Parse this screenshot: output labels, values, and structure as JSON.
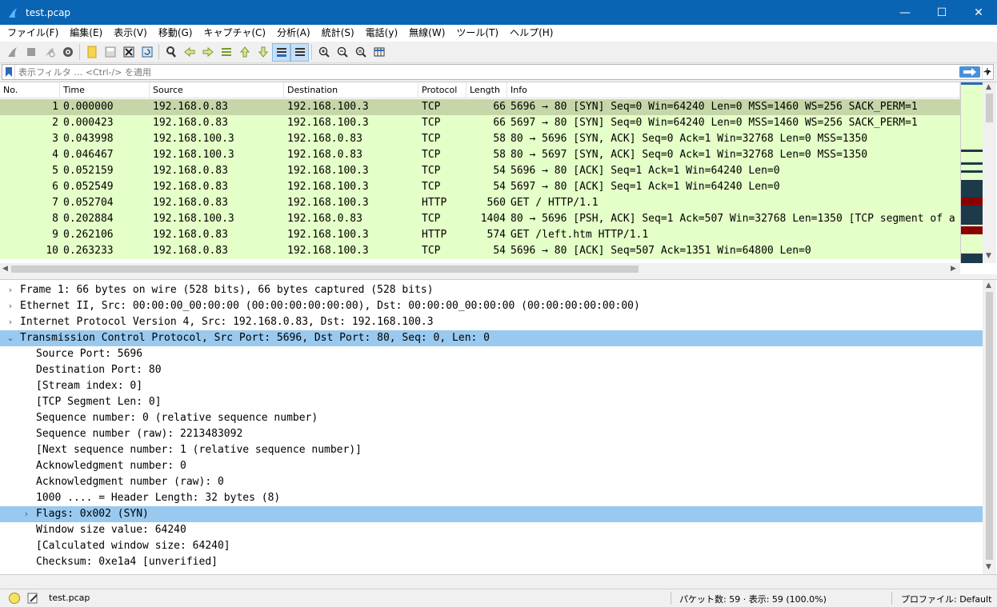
{
  "window": {
    "title": "test.pcap",
    "minimize": "—",
    "maximize": "☐",
    "close": "✕"
  },
  "menu": [
    "ファイル(F)",
    "編集(E)",
    "表示(V)",
    "移動(G)",
    "キャプチャ(C)",
    "分析(A)",
    "統計(S)",
    "電話(y)",
    "無線(W)",
    "ツール(T)",
    "ヘルプ(H)"
  ],
  "filter": {
    "placeholder": "表示フィルタ … <Ctrl-/> を適用",
    "value": ""
  },
  "packet_list": {
    "columns": [
      "No.",
      "Time",
      "Source",
      "Destination",
      "Protocol",
      "Length",
      "Info"
    ],
    "rows": [
      {
        "no": "1",
        "time": "0.000000",
        "src": "192.168.0.83",
        "dst": "192.168.100.3",
        "proto": "TCP",
        "len": "66",
        "info": "5696 → 80 [SYN] Seq=0 Win=64240 Len=0 MSS=1460 WS=256 SACK_PERM=1"
      },
      {
        "no": "2",
        "time": "0.000423",
        "src": "192.168.0.83",
        "dst": "192.168.100.3",
        "proto": "TCP",
        "len": "66",
        "info": "5697 → 80 [SYN] Seq=0 Win=64240 Len=0 MSS=1460 WS=256 SACK_PERM=1"
      },
      {
        "no": "3",
        "time": "0.043998",
        "src": "192.168.100.3",
        "dst": "192.168.0.83",
        "proto": "TCP",
        "len": "58",
        "info": "80 → 5696 [SYN, ACK] Seq=0 Ack=1 Win=32768 Len=0 MSS=1350"
      },
      {
        "no": "4",
        "time": "0.046467",
        "src": "192.168.100.3",
        "dst": "192.168.0.83",
        "proto": "TCP",
        "len": "58",
        "info": "80 → 5697 [SYN, ACK] Seq=0 Ack=1 Win=32768 Len=0 MSS=1350"
      },
      {
        "no": "5",
        "time": "0.052159",
        "src": "192.168.0.83",
        "dst": "192.168.100.3",
        "proto": "TCP",
        "len": "54",
        "info": "5696 → 80 [ACK] Seq=1 Ack=1 Win=64240 Len=0"
      },
      {
        "no": "6",
        "time": "0.052549",
        "src": "192.168.0.83",
        "dst": "192.168.100.3",
        "proto": "TCP",
        "len": "54",
        "info": "5697 → 80 [ACK] Seq=1 Ack=1 Win=64240 Len=0"
      },
      {
        "no": "7",
        "time": "0.052704",
        "src": "192.168.0.83",
        "dst": "192.168.100.3",
        "proto": "HTTP",
        "len": "560",
        "info": "GET / HTTP/1.1"
      },
      {
        "no": "8",
        "time": "0.202884",
        "src": "192.168.100.3",
        "dst": "192.168.0.83",
        "proto": "TCP",
        "len": "1404",
        "info": "80 → 5696 [PSH, ACK] Seq=1 Ack=507 Win=32768 Len=1350 [TCP segment of a"
      },
      {
        "no": "9",
        "time": "0.262106",
        "src": "192.168.0.83",
        "dst": "192.168.100.3",
        "proto": "HTTP",
        "len": "574",
        "info": "GET /left.htm HTTP/1.1"
      },
      {
        "no": "10",
        "time": "0.263233",
        "src": "192.168.0.83",
        "dst": "192.168.100.3",
        "proto": "TCP",
        "len": "54",
        "info": "5696 → 80 [ACK] Seq=507 Ack=1351 Win=64800 Len=0"
      }
    ]
  },
  "details": [
    {
      "text": "Frame 1: 66 bytes on wire (528 bits), 66 bytes captured (528 bits)",
      "indent": 0,
      "expander": "›",
      "hl": false
    },
    {
      "text": "Ethernet II, Src: 00:00:00_00:00:00 (00:00:00:00:00:00), Dst: 00:00:00_00:00:00 (00:00:00:00:00:00)",
      "indent": 0,
      "expander": "›",
      "hl": false
    },
    {
      "text": "Internet Protocol Version 4, Src: 192.168.0.83, Dst: 192.168.100.3",
      "indent": 0,
      "expander": "›",
      "hl": false
    },
    {
      "text": "Transmission Control Protocol, Src Port: 5696, Dst Port: 80, Seq: 0, Len: 0",
      "indent": 0,
      "expander": "⌄",
      "hl": true
    },
    {
      "text": "Source Port: 5696",
      "indent": 1,
      "expander": "",
      "hl": false
    },
    {
      "text": "Destination Port: 80",
      "indent": 1,
      "expander": "",
      "hl": false
    },
    {
      "text": "[Stream index: 0]",
      "indent": 1,
      "expander": "",
      "hl": false
    },
    {
      "text": "[TCP Segment Len: 0]",
      "indent": 1,
      "expander": "",
      "hl": false
    },
    {
      "text": "Sequence number: 0    (relative sequence number)",
      "indent": 1,
      "expander": "",
      "hl": false
    },
    {
      "text": "Sequence number (raw): 2213483092",
      "indent": 1,
      "expander": "",
      "hl": false
    },
    {
      "text": "[Next sequence number: 1    (relative sequence number)]",
      "indent": 1,
      "expander": "",
      "hl": false
    },
    {
      "text": "Acknowledgment number: 0",
      "indent": 1,
      "expander": "",
      "hl": false
    },
    {
      "text": "Acknowledgment number (raw): 0",
      "indent": 1,
      "expander": "",
      "hl": false
    },
    {
      "text": "1000 .... = Header Length: 32 bytes (8)",
      "indent": 1,
      "expander": "",
      "hl": false
    },
    {
      "text": "Flags: 0x002 (SYN)",
      "indent": 1,
      "expander": "›",
      "hl": true
    },
    {
      "text": "Window size value: 64240",
      "indent": 1,
      "expander": "",
      "hl": false
    },
    {
      "text": "[Calculated window size: 64240]",
      "indent": 1,
      "expander": "",
      "hl": false
    },
    {
      "text": "Checksum: 0xe1a4 [unverified]",
      "indent": 1,
      "expander": "",
      "hl": false
    }
  ],
  "status": {
    "file": "test.pcap",
    "packets": "パケット数: 59 · 表示: 59 (100.0%)",
    "profile": "プロファイル: Default"
  },
  "colors": {
    "tcp_row": "#e4ffc7",
    "selected_row": "#c7d6a8",
    "detail_highlight": "#99c9ef",
    "titlebar": "#0a64b4"
  },
  "toolbar_icons": [
    "shark-start-icon",
    "stop-icon",
    "restart-icon",
    "options-gear-icon",
    "open-file-icon",
    "save-icon",
    "close-file-icon",
    "reload-icon",
    "find-icon",
    "go-back-icon",
    "go-forward-icon",
    "go-to-packet-icon",
    "first-packet-icon",
    "last-packet-icon",
    "autoscroll-icon",
    "colorize-icon",
    "zoom-in-icon",
    "zoom-out-icon",
    "zoom-normal-icon",
    "resize-columns-icon"
  ]
}
